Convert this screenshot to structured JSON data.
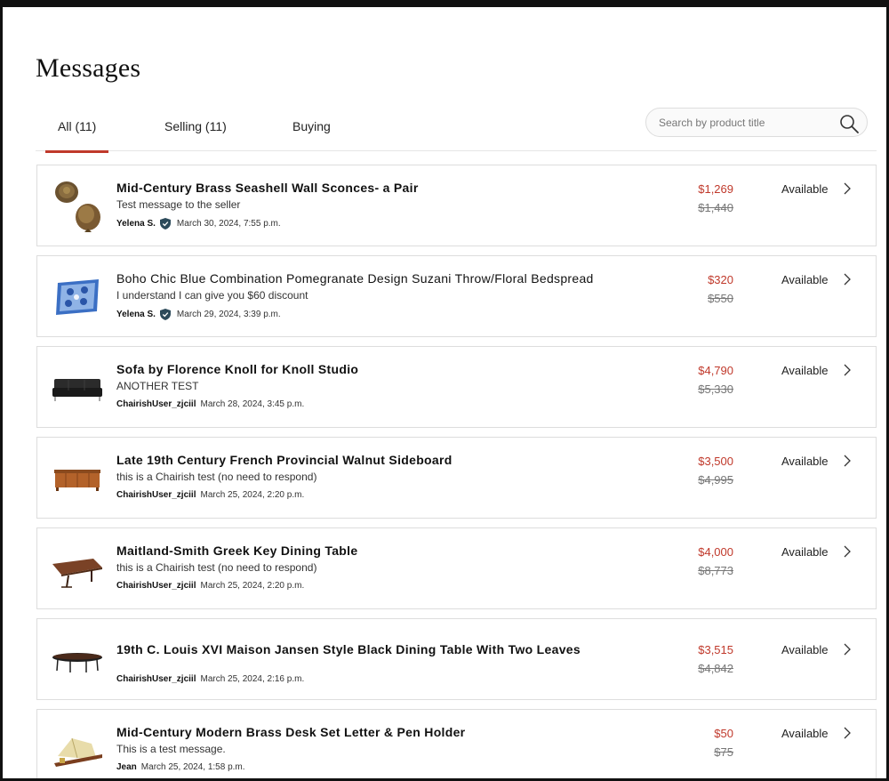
{
  "page": {
    "title": "Messages"
  },
  "tabs": [
    {
      "label": "All (11)",
      "active": true
    },
    {
      "label": "Selling (11)",
      "active": false
    },
    {
      "label": "Buying",
      "active": false
    }
  ],
  "search": {
    "placeholder": "Search by product title",
    "icon": "search-icon"
  },
  "colors": {
    "accent": "#c0392b",
    "badge": "#2c4a5a"
  },
  "messages": [
    {
      "title": "Mid-Century Brass Seashell Wall Sconces- a Pair",
      "snippet": "Test message to the seller",
      "sender": "Yelena S.",
      "verified": true,
      "date": "March 30, 2024, 7:55 p.m.",
      "price": "$1,269",
      "original_price": "$1,440",
      "status": "Available",
      "thumb": "brass-seashell-sconces"
    },
    {
      "title": "Boho Chic Blue Combination Pomegranate Design Suzani Throw/Floral Bedspread",
      "snippet": "I understand I can give you $60 discount",
      "sender": "Yelena S.",
      "verified": true,
      "date": "March 29, 2024, 3:39 p.m.",
      "price": "$320",
      "original_price": "$550",
      "status": "Available",
      "thumb": "blue-suzani-throw"
    },
    {
      "title": "Sofa by Florence Knoll for Knoll Studio",
      "snippet": "ANOTHER TEST",
      "sender": "ChairishUser_zjciil",
      "verified": false,
      "date": "March 28, 2024, 3:45 p.m.",
      "price": "$4,790",
      "original_price": "$5,330",
      "status": "Available",
      "thumb": "black-leather-sofa"
    },
    {
      "title": "Late 19th Century French Provincial Walnut Sideboard",
      "snippet": "this is a Chairish test (no need to respond)",
      "sender": "ChairishUser_zjciil",
      "verified": false,
      "date": "March 25, 2024, 2:20 p.m.",
      "price": "$3,500",
      "original_price": "$4,995",
      "status": "Available",
      "thumb": "walnut-sideboard"
    },
    {
      "title": "Maitland-Smith Greek Key Dining Table",
      "snippet": "this is a Chairish test (no need to respond)",
      "sender": "ChairishUser_zjciil",
      "verified": false,
      "date": "March 25, 2024, 2:20 p.m.",
      "price": "$4,000",
      "original_price": "$8,773",
      "status": "Available",
      "thumb": "greek-key-dining-table"
    },
    {
      "title": "19th C. Louis XVI Maison Jansen Style Black Dining Table With Two Leaves",
      "snippet": "",
      "sender": "ChairishUser_zjciil",
      "verified": false,
      "date": "March 25, 2024, 2:16 p.m.",
      "price": "$3,515",
      "original_price": "$4,842",
      "status": "Available",
      "thumb": "black-dining-table"
    },
    {
      "title": "Mid-Century Modern Brass Desk Set Letter & Pen Holder",
      "snippet": "This is a test message.",
      "sender": "Jean",
      "verified": false,
      "date": "March 25, 2024, 1:58 p.m.",
      "price": "$50",
      "original_price": "$75",
      "status": "Available",
      "thumb": "brass-desk-set"
    }
  ]
}
